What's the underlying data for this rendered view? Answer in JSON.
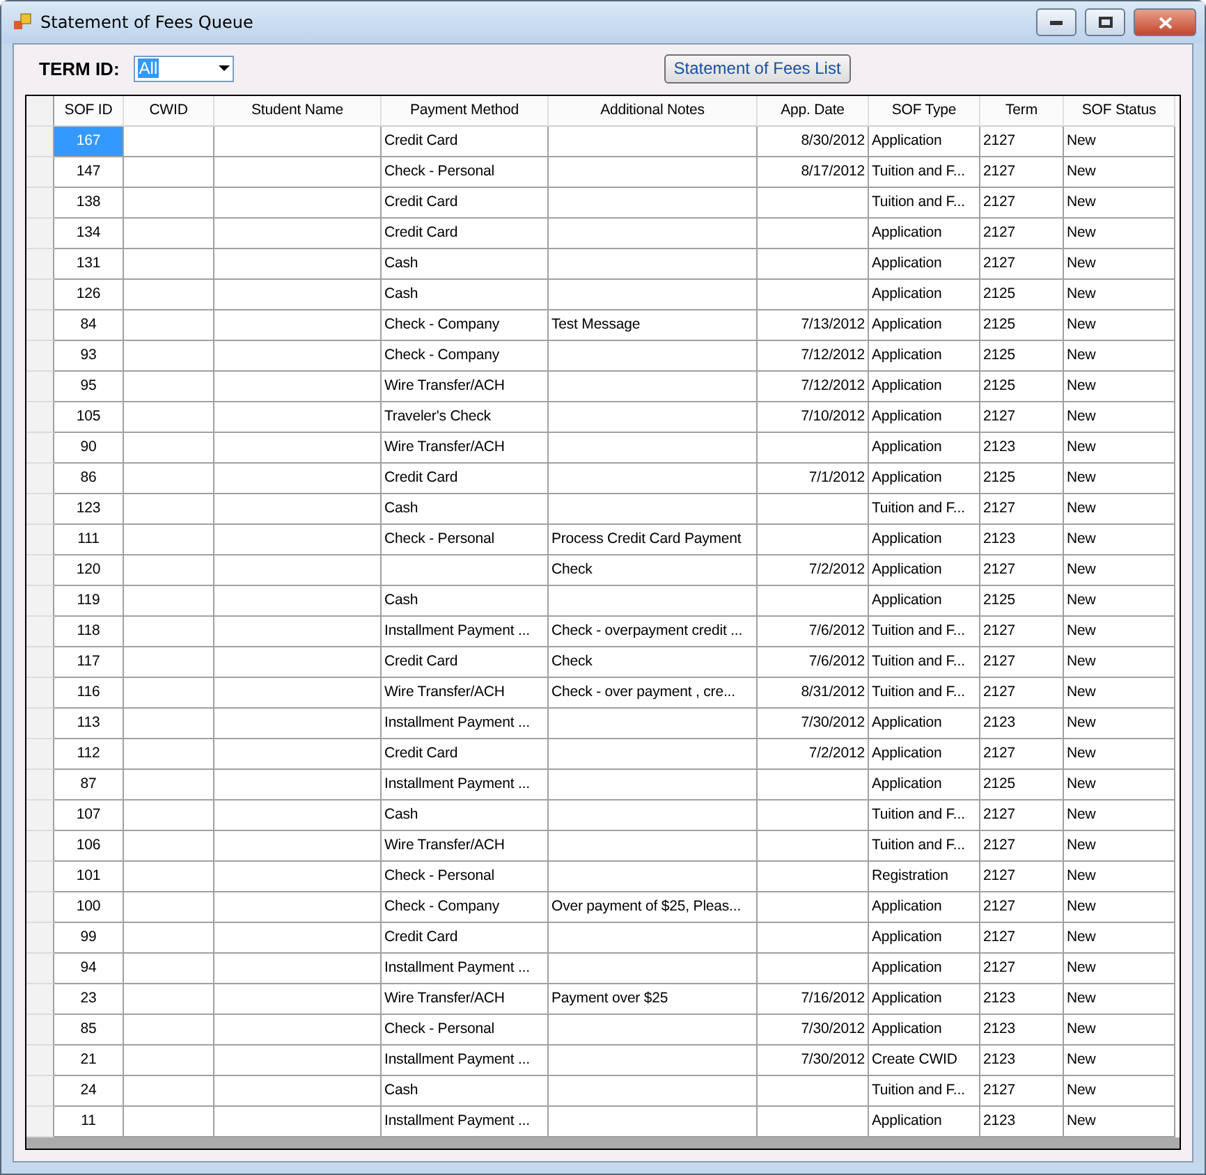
{
  "window": {
    "title": "Statement of Fees Queue"
  },
  "filter": {
    "label": "TERM ID:",
    "value": "All"
  },
  "list_button": {
    "label": "Statement of Fees List"
  },
  "table": {
    "columns": [
      "SOF ID",
      "CWID",
      "Student Name",
      "Payment Method",
      "Additional Notes",
      "App. Date",
      "SOF Type",
      "Term",
      "SOF Status"
    ],
    "rows": [
      {
        "selected": true,
        "cells": [
          "167",
          "",
          "",
          "Credit Card",
          "",
          "8/30/2012",
          "Application",
          "2127",
          "New"
        ]
      },
      {
        "selected": false,
        "cells": [
          "147",
          "",
          "",
          "Check - Personal",
          "",
          "8/17/2012",
          "Tuition and F...",
          "2127",
          "New"
        ]
      },
      {
        "selected": false,
        "cells": [
          "138",
          "",
          "",
          "Credit Card",
          "",
          "",
          "Tuition and F...",
          "2127",
          "New"
        ]
      },
      {
        "selected": false,
        "cells": [
          "134",
          "",
          "",
          "Credit Card",
          "",
          "",
          "Application",
          "2127",
          "New"
        ]
      },
      {
        "selected": false,
        "cells": [
          "131",
          "",
          "",
          "Cash",
          "",
          "",
          "Application",
          "2127",
          "New"
        ]
      },
      {
        "selected": false,
        "cells": [
          "126",
          "",
          "",
          "Cash",
          "",
          "",
          "Application",
          "2125",
          "New"
        ]
      },
      {
        "selected": false,
        "cells": [
          "84",
          "",
          "",
          "Check - Company",
          "Test Message",
          "7/13/2012",
          "Application",
          "2125",
          "New"
        ]
      },
      {
        "selected": false,
        "cells": [
          "93",
          "",
          "",
          "Check - Company",
          "",
          "7/12/2012",
          "Application",
          "2125",
          "New"
        ]
      },
      {
        "selected": false,
        "cells": [
          "95",
          "",
          "",
          "Wire Transfer/ACH",
          "",
          "7/12/2012",
          "Application",
          "2125",
          "New"
        ]
      },
      {
        "selected": false,
        "cells": [
          "105",
          "",
          "",
          "Traveler's Check",
          "",
          "7/10/2012",
          "Application",
          "2127",
          "New"
        ]
      },
      {
        "selected": false,
        "cells": [
          "90",
          "",
          "",
          "Wire Transfer/ACH",
          "",
          "",
          "Application",
          "2123",
          "New"
        ]
      },
      {
        "selected": false,
        "cells": [
          "86",
          "",
          "",
          "Credit Card",
          "",
          "7/1/2012",
          "Application",
          "2125",
          "New"
        ]
      },
      {
        "selected": false,
        "cells": [
          "123",
          "",
          "",
          "Cash",
          "",
          "",
          "Tuition and F...",
          "2127",
          "New"
        ]
      },
      {
        "selected": false,
        "cells": [
          "111",
          "",
          "",
          "Check - Personal",
          "Process Credit Card Payment",
          "",
          "Application",
          "2123",
          "New"
        ]
      },
      {
        "selected": false,
        "cells": [
          "120",
          "",
          "",
          "",
          "Check",
          "7/2/2012",
          "Application",
          "2127",
          "New"
        ]
      },
      {
        "selected": false,
        "cells": [
          "119",
          "",
          "",
          "Cash",
          "",
          "",
          "Application",
          "2125",
          "New"
        ]
      },
      {
        "selected": false,
        "cells": [
          "118",
          "",
          "",
          "Installment Payment ...",
          "Check - overpayment credit ...",
          "7/6/2012",
          "Tuition and F...",
          "2127",
          "New"
        ]
      },
      {
        "selected": false,
        "cells": [
          "117",
          "",
          "",
          "Credit Card",
          "Check",
          "7/6/2012",
          "Tuition and F...",
          "2127",
          "New"
        ]
      },
      {
        "selected": false,
        "cells": [
          "116",
          "",
          "",
          "Wire Transfer/ACH",
          "Check - over payment , cre...",
          "8/31/2012",
          "Tuition and F...",
          "2127",
          "New"
        ]
      },
      {
        "selected": false,
        "cells": [
          "113",
          "",
          "",
          "Installment Payment ...",
          "",
          "7/30/2012",
          "Application",
          "2123",
          "New"
        ]
      },
      {
        "selected": false,
        "cells": [
          "112",
          "",
          "",
          "Credit Card",
          "",
          "7/2/2012",
          "Application",
          "2127",
          "New"
        ]
      },
      {
        "selected": false,
        "cells": [
          "87",
          "",
          "",
          "Installment Payment ...",
          "",
          "",
          "Application",
          "2125",
          "New"
        ]
      },
      {
        "selected": false,
        "cells": [
          "107",
          "",
          "",
          "Cash",
          "",
          "",
          "Tuition and F...",
          "2127",
          "New"
        ]
      },
      {
        "selected": false,
        "cells": [
          "106",
          "",
          "",
          "Wire Transfer/ACH",
          "",
          "",
          "Tuition and F...",
          "2127",
          "New"
        ]
      },
      {
        "selected": false,
        "cells": [
          "101",
          "",
          "",
          "Check - Personal",
          "",
          "",
          "Registration",
          "2127",
          "New"
        ]
      },
      {
        "selected": false,
        "cells": [
          "100",
          "",
          "",
          "Check - Company",
          "Over payment of $25, Pleas...",
          "",
          "Application",
          "2127",
          "New"
        ]
      },
      {
        "selected": false,
        "cells": [
          "99",
          "",
          "",
          "Credit Card",
          "",
          "",
          "Application",
          "2127",
          "New"
        ]
      },
      {
        "selected": false,
        "cells": [
          "94",
          "",
          "",
          "Installment Payment ...",
          "",
          "",
          "Application",
          "2127",
          "New"
        ]
      },
      {
        "selected": false,
        "cells": [
          "23",
          "",
          "",
          "Wire Transfer/ACH",
          "Payment over $25",
          "7/16/2012",
          "Application",
          "2123",
          "New"
        ]
      },
      {
        "selected": false,
        "cells": [
          "85",
          "",
          "",
          "Check - Personal",
          "",
          "7/30/2012",
          "Application",
          "2123",
          "New"
        ]
      },
      {
        "selected": false,
        "cells": [
          "21",
          "",
          "",
          "Installment Payment ...",
          "",
          "7/30/2012",
          "Create CWID",
          "2123",
          "New"
        ]
      },
      {
        "selected": false,
        "cells": [
          "24",
          "",
          "",
          "Cash",
          "",
          "",
          "Tuition and F...",
          "2127",
          "New"
        ]
      },
      {
        "selected": false,
        "cells": [
          "11",
          "",
          "",
          "Installment Payment ...",
          "",
          "",
          "Application",
          "2123",
          "New"
        ]
      }
    ]
  }
}
